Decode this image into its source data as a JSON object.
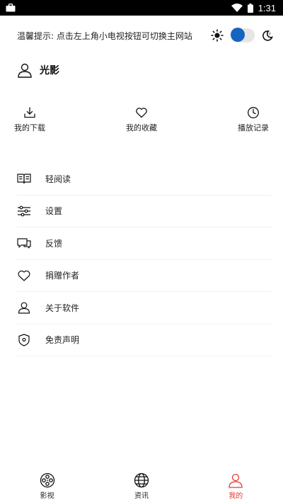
{
  "status_bar": {
    "time": "1:31",
    "icons": [
      "briefcase-icon",
      "wifi-icon",
      "battery-icon"
    ]
  },
  "tip": {
    "text": "温馨提示: 点击左上角小电视按钮可切换主网站",
    "theme_toggle_state": "off",
    "accent_color": "#1565c0"
  },
  "profile": {
    "username": "光影"
  },
  "quick_actions": [
    {
      "label": "我的下载",
      "icon": "download-icon"
    },
    {
      "label": "我的收藏",
      "icon": "heart-icon"
    },
    {
      "label": "播放记录",
      "icon": "clock-icon"
    }
  ],
  "menu": [
    {
      "label": "轻阅读",
      "icon": "book-icon"
    },
    {
      "label": "设置",
      "icon": "sliders-icon"
    },
    {
      "label": "反馈",
      "icon": "feedback-icon"
    },
    {
      "label": "捐赠作者",
      "icon": "heart-icon"
    },
    {
      "label": "关于软件",
      "icon": "user-icon"
    },
    {
      "label": "免责声明",
      "icon": "shield-icon"
    }
  ],
  "bottom_nav": {
    "active_color": "#e53935",
    "items": [
      {
        "label": "影视",
        "icon": "film-reel-icon",
        "active": false
      },
      {
        "label": "资讯",
        "icon": "globe-icon",
        "active": false
      },
      {
        "label": "我的",
        "icon": "user-icon",
        "active": true
      }
    ]
  }
}
